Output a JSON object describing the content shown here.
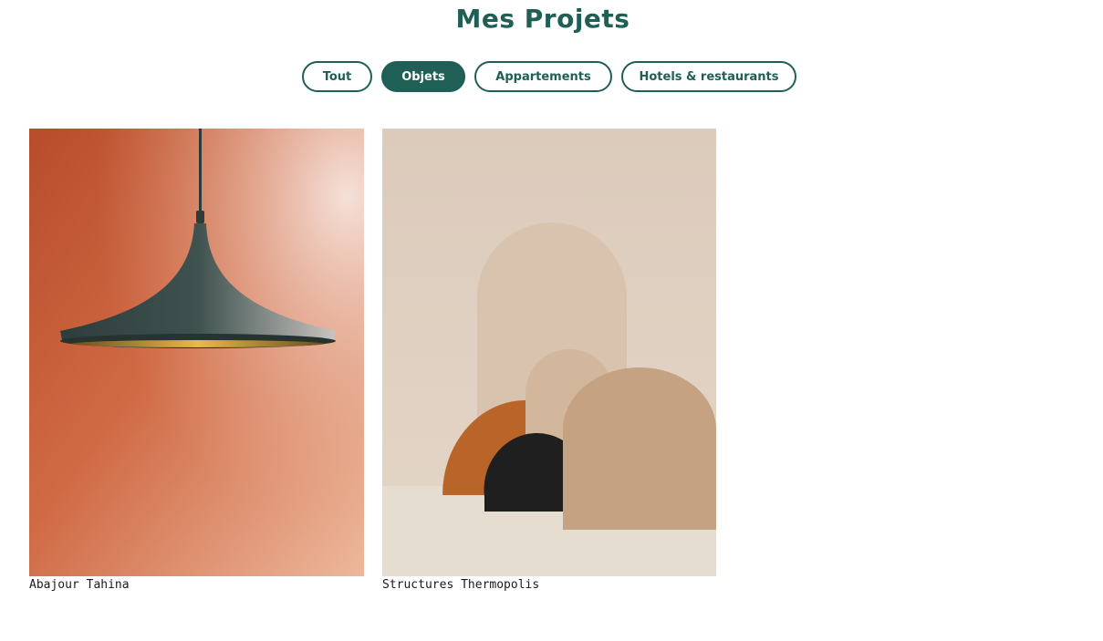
{
  "page": {
    "title": "Mes Projets"
  },
  "filters": [
    {
      "label": "Tout",
      "active": false
    },
    {
      "label": "Objets",
      "active": true
    },
    {
      "label": "Appartements",
      "active": false
    },
    {
      "label": "Hotels & restaurants",
      "active": false
    }
  ],
  "projects": [
    {
      "title": "Abajour Tahina"
    },
    {
      "title": "Structures Thermopolis"
    }
  ],
  "colors": {
    "accent": "#1f5f55",
    "background": "#ffffff"
  }
}
